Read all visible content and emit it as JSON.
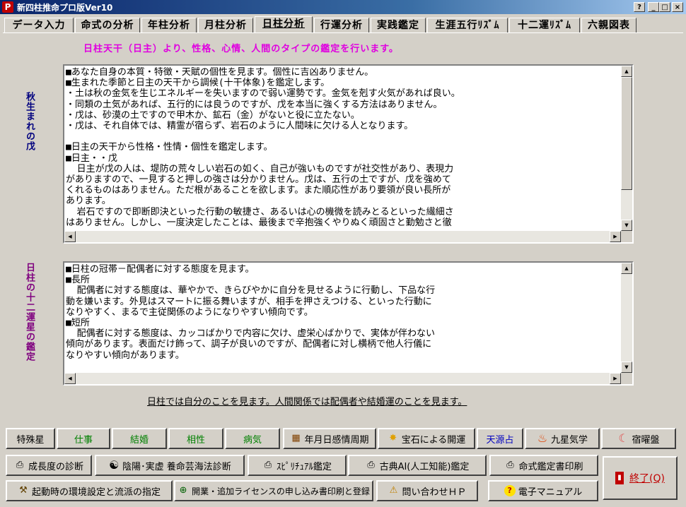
{
  "window": {
    "title": "新四柱推命プロ版Ver10",
    "controls": [
      "?",
      "_",
      "□",
      "×"
    ]
  },
  "tabs": [
    {
      "label": "データ入力"
    },
    {
      "label": "命式の分析"
    },
    {
      "label": "年柱分析"
    },
    {
      "label": "月柱分析"
    },
    {
      "label": "日柱分析",
      "active": true
    },
    {
      "label": "行運分析"
    },
    {
      "label": "実践鑑定"
    },
    {
      "label": "生涯五行ﾘｽﾞﾑ"
    },
    {
      "label": "十二運ﾘｽﾞﾑ"
    },
    {
      "label": "六親図表"
    }
  ],
  "heading": "日柱天干（日主）より、性格、心情、人間のタイプの鑑定を行います。",
  "labels": {
    "top": "秋生まれの戊",
    "bottom": "日柱の十二運星の鑑定"
  },
  "top_text": "■あなた自身の本質・特徴・天賦の個性を見ます。個性に吉凶ありません。\n■生まれた季節と日主の天干から調候(十干体象)を鑑定します。\n・土は秋の金気を生じエネルギーを失いますので弱い運勢です。金気を剋す火気があれば良い。\n・同類の土気があれば、五行的には良うのですが、戊を本当に強くする方法はありません。\n・戊は、砂漠の土ですので甲木か、鉱石（金）がないと役に立たない。\n・戊は、それ自体では、精霊が宿らず、岩石のように人間味に欠ける人となります。\n\n■日主の天干から性格・性情・個性を鑑定します。\n■日主・・戊\n  日主が戊の人は、堤防の荒々しい岩石の如く、自己が強いものですが社交性があり、表現力\nがありますので、一見すると押しの強さは分かりません。戊は、五行の土ですが、戊を強めて\nくれるものはありません。ただ根があることを欲します。また順応性があり要領が良い長所が\nあります。\n  岩石ですので即断即決といった行動の敏捷さ、あるいは心の機微を読みとるといった繊細さ\nはありません。しかし、一度決定したことは、最後まで辛抱強くやりぬく頑固さと勤勉さと徹",
  "bottom_text": "■日柱の冠帯－配偶者に対する態度を見ます。\n■長所\n  配偶者に対する態度は、華やかで、きらびやかに自分を見せるように行動し、下品な行\n動を嫌います。外見はスマートに振る舞いますが、相手を押さえつける、といった行動に\nなりやすく、まるで主従関係のようになりやすい傾向です。\n■短所\n  配偶者に対する態度は、カッコばかりで内容に欠け、虚栄心ばかりで、実体が伴わない\n傾向があります。表面だけ飾って、調子が良いのですが、配偶者に対し横柄で他人行儀に\nなりやすい傾向があります。",
  "note": "日柱では自分のことを見ます。人間関係では配偶者や結婚運のことを見ます。",
  "buttons": {
    "row1": [
      {
        "label": "特殊星",
        "icon": ""
      },
      {
        "label": "仕事",
        "icon": ""
      },
      {
        "label": "結婚",
        "icon": ""
      },
      {
        "label": "相性",
        "icon": ""
      },
      {
        "label": "病気",
        "icon": ""
      },
      {
        "label": "年月日感情周期",
        "icon": "calendar-icon"
      },
      {
        "label": "宝石による開運",
        "icon": "sparkle-icon"
      },
      {
        "label": "天源占",
        "icon": ""
      },
      {
        "label": "九星気学",
        "icon": "flame-icon"
      },
      {
        "label": "宿曜盤",
        "icon": "moon-icon"
      }
    ],
    "row2": [
      {
        "label": "成長度の診断",
        "icon": "printer-icon"
      },
      {
        "label": "陰陽･実虚 養命芸海法診断",
        "icon": "yinyang-icon"
      },
      {
        "label": "ｽﾋﾟﾘﾁｭｱﾙ鑑定",
        "icon": "printer-icon"
      },
      {
        "label": "古典AI(人工知能)鑑定",
        "icon": "printer-icon"
      },
      {
        "label": "命式鑑定書印刷",
        "icon": "printer-icon"
      }
    ],
    "row3": [
      {
        "label": "起動時の環境設定と流派の指定",
        "icon": "wrench-icon"
      },
      {
        "label": "開業・追加ライセンスの申し込み書印刷と登録",
        "icon": "globe-icon"
      },
      {
        "label": "問い合わせＨＰ",
        "icon": "warning-icon"
      },
      {
        "label": "電子マニュアル",
        "icon": "help-icon"
      }
    ],
    "exit": {
      "label": "終了(Q)",
      "icon": "exit-icon"
    }
  },
  "colors": {
    "accent_heading": "#e000e0",
    "label_top": "#00007f",
    "label_bottom": "#7f007f",
    "green_button": "#008000",
    "blue_button": "#0000c0",
    "exit_red": "#c00000"
  }
}
